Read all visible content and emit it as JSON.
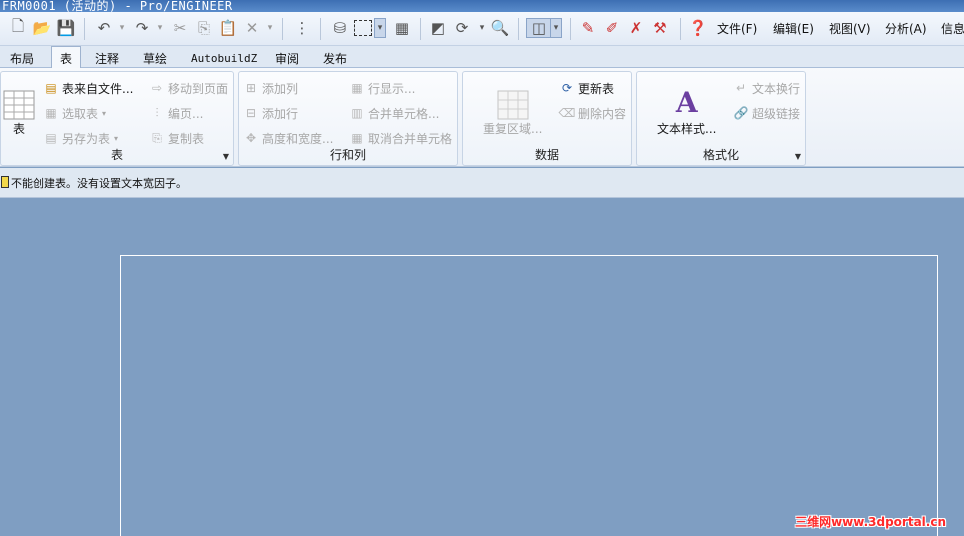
{
  "window": {
    "title": "FRM0001 (活动的) - Pro/ENGINEER"
  },
  "menus": [
    "文件(F)",
    "编辑(E)",
    "视图(V)",
    "分析(A)",
    "信息"
  ],
  "tabs": [
    "布局",
    "表",
    "注释",
    "草绘",
    "AutobuildZ",
    "审阅",
    "发布"
  ],
  "active_tab": "表",
  "groups": {
    "table": {
      "title": "表",
      "big_label": "表",
      "items": [
        "表来自文件...",
        "选取表",
        "另存为表",
        "移动到页面",
        "编页...",
        "复制表"
      ]
    },
    "rows_cols": {
      "title": "行和列",
      "items": [
        "添加列",
        "添加行",
        "高度和宽度...",
        "行显示...",
        "合并单元格...",
        "取消合并单元格"
      ]
    },
    "data": {
      "title": "数据",
      "big_label": "重复区域...",
      "items": [
        "更新表",
        "删除内容"
      ]
    },
    "format": {
      "title": "格式化",
      "big_label": "文本样式...",
      "items": [
        "文本换行",
        "超级链接"
      ]
    }
  },
  "status": {
    "message": "不能创建表。没有设置文本宽因子。"
  },
  "watermark": "三维网www.3dportal.cn"
}
